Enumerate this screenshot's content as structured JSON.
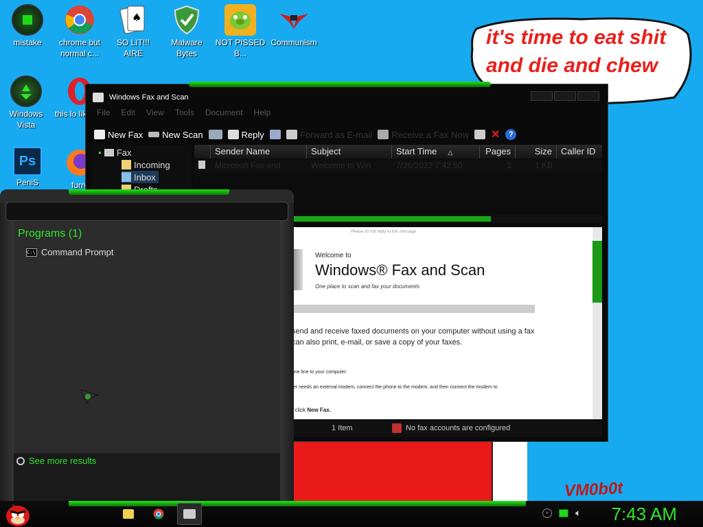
{
  "desktop": {
    "icons": [
      {
        "label": "mistake",
        "icon": "razer-green-icon"
      },
      {
        "label": "chrome but normal c...",
        "icon": "chrome-icon"
      },
      {
        "label": "SO LIT!!! AIRE",
        "icon": "solitaire-cards-icon"
      },
      {
        "label": "Malware Bytes",
        "icon": "shield-check-icon"
      },
      {
        "label": "NOT PISSED B...",
        "icon": "green-pig-icon"
      },
      {
        "label": "Communism",
        "icon": "winged-emblem-icon"
      },
      {
        "label": "Windows Vista",
        "icon": "recycle-orb-icon"
      },
      {
        "label": "this lo like a v",
        "icon": "opera-icon"
      },
      {
        "label": "PeniS",
        "icon": "photoshop-icon"
      },
      {
        "label": "furry",
        "icon": "firefox-icon"
      }
    ],
    "bubble_text": "it's time to eat shit and die and chew",
    "signature": "VM0b0t"
  },
  "fax_window": {
    "title": "Windows Fax and Scan",
    "menu": [
      "File",
      "Edit",
      "View",
      "Tools",
      "Document",
      "Help"
    ],
    "toolbar": {
      "new_fax": "New Fax",
      "new_scan": "New Scan",
      "reply": "Reply",
      "forward_email": "Forward as E-mail",
      "receive": "Receive a Fax Now"
    },
    "tree": {
      "root": "Fax",
      "incoming": "Incoming",
      "inbox": "Inbox",
      "drafts": "Drafts"
    },
    "columns": [
      "Sender Name",
      "Subject",
      "Start Time",
      "Pages",
      "Size",
      "Caller ID"
    ],
    "row": {
      "sender": "Microsoft Fax and",
      "subject": "Welcome to Win",
      "start_time": "7/26/2022 7:42:50",
      "pages": "1",
      "size": "1 KB",
      "caller": ""
    },
    "preview": {
      "note": "Please do not reply to this message",
      "welcome": "Welcome to",
      "product": "Windows® Fax and Scan",
      "tagline": "One place to scan and fax your documents",
      "p1": "send and receive faxed documents on your computer without using a fax",
      "p2": "can also print, e-mail, or save a copy of your faxes.",
      "p3": "one line to your computer.",
      "p4": "ter needs an external modem, connect the phone to the modem, and then connect the modem to",
      "p4b": "r.",
      "p5_prefix": ", click ",
      "p5_bold": "New Fax."
    },
    "status": {
      "count": "1 Item",
      "accounts": "No fax accounts are configured"
    }
  },
  "start_menu": {
    "programs_header": "Programs (1)",
    "program_item": "Command Prompt",
    "see_more": "See more results"
  },
  "taskbar": {
    "clock": "7:43 AM",
    "pinned": [
      "folder-icon",
      "chrome-icon",
      "fax-icon"
    ]
  },
  "colors": {
    "accent_green": "#2fe62a",
    "desktop_blue": "#18aaf0",
    "bubble_red": "#e8201c"
  }
}
